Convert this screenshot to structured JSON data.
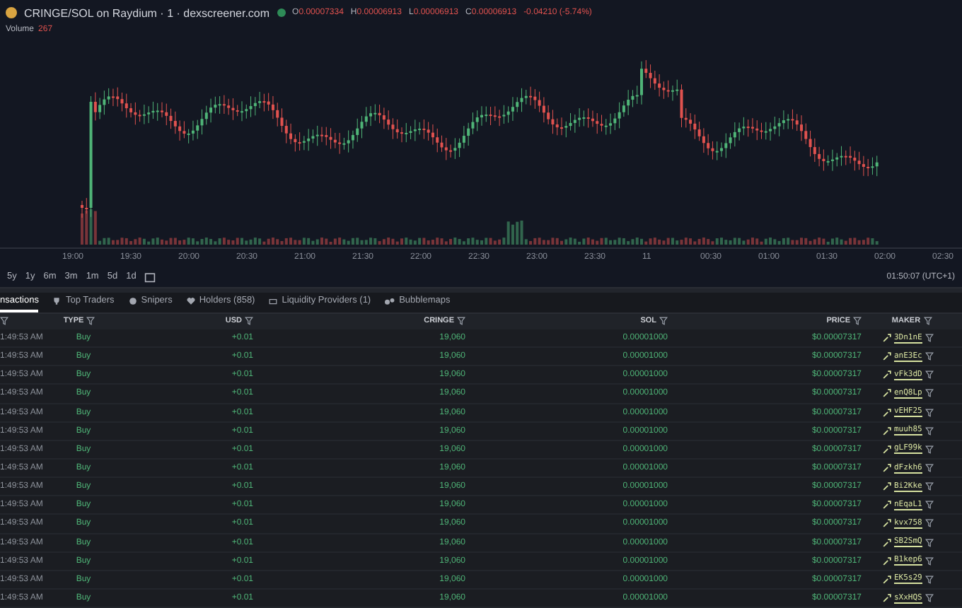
{
  "chart_header": {
    "title": "CRINGE/SOL on Raydium · 1 · dexscreener.com",
    "ohlc": [
      {
        "label": "O",
        "value": "0.00007334"
      },
      {
        "label": "H",
        "value": "0.00006913"
      },
      {
        "label": "L",
        "value": "0.00006913"
      },
      {
        "label": "C",
        "value": "0.00006913"
      }
    ],
    "change": "-0.04210 (-5.74%)",
    "volume_label": "Volume",
    "volume_value": "267"
  },
  "chart": {
    "kind": "picture",
    "time_labels": [
      "19:00",
      "19:30",
      "20:00",
      "20:30",
      "21:00",
      "21:30",
      "22:00",
      "22:30",
      "23:00",
      "23:30",
      "11",
      "00:30",
      "01:00",
      "01:30",
      "02:00",
      "02:30"
    ]
  },
  "timeframes": [
    {
      "label": "5y"
    },
    {
      "label": "1y"
    },
    {
      "label": "6m"
    },
    {
      "label": "3m"
    },
    {
      "label": "1m"
    },
    {
      "label": "5d"
    },
    {
      "label": "1d"
    }
  ],
  "clock": "01:50:07 (UTC+1)",
  "tabs": [
    {
      "label": "nsactions",
      "selected": true,
      "kind": "plain"
    },
    {
      "label": "Top Traders",
      "selected": false,
      "kind": "traders"
    },
    {
      "label": "Snipers",
      "selected": false,
      "kind": "snipers"
    },
    {
      "label": "Holders (858)",
      "selected": false,
      "kind": "holders"
    },
    {
      "label": "Liquidity Providers (1)",
      "selected": false,
      "kind": "liquidity"
    },
    {
      "label": "Bubblemaps",
      "selected": false,
      "kind": "bubbles"
    }
  ],
  "table": {
    "columns": [
      "TYPE",
      "USD",
      "CRINGE",
      "SOL",
      "PRICE",
      "MAKER"
    ],
    "rows": [
      {
        "time": "1:49:53 AM",
        "type": "Buy",
        "usd": "+0.01",
        "cringe": "19,060",
        "sol": "0.00001000",
        "price": "$0.00007317",
        "maker": "3Dn1nE"
      },
      {
        "time": "1:49:53 AM",
        "type": "Buy",
        "usd": "+0.01",
        "cringe": "19,060",
        "sol": "0.00001000",
        "price": "$0.00007317",
        "maker": "anE3Ec"
      },
      {
        "time": "1:49:53 AM",
        "type": "Buy",
        "usd": "+0.01",
        "cringe": "19,060",
        "sol": "0.00001000",
        "price": "$0.00007317",
        "maker": "vFk3dD"
      },
      {
        "time": "1:49:53 AM",
        "type": "Buy",
        "usd": "+0.01",
        "cringe": "19,060",
        "sol": "0.00001000",
        "price": "$0.00007317",
        "maker": "enQ8Lp"
      },
      {
        "time": "1:49:53 AM",
        "type": "Buy",
        "usd": "+0.01",
        "cringe": "19,060",
        "sol": "0.00001000",
        "price": "$0.00007317",
        "maker": "vEHF25"
      },
      {
        "time": "1:49:53 AM",
        "type": "Buy",
        "usd": "+0.01",
        "cringe": "19,060",
        "sol": "0.00001000",
        "price": "$0.00007317",
        "maker": "muuh85"
      },
      {
        "time": "1:49:53 AM",
        "type": "Buy",
        "usd": "+0.01",
        "cringe": "19,060",
        "sol": "0.00001000",
        "price": "$0.00007317",
        "maker": "gLF99k"
      },
      {
        "time": "1:49:53 AM",
        "type": "Buy",
        "usd": "+0.01",
        "cringe": "19,060",
        "sol": "0.00001000",
        "price": "$0.00007317",
        "maker": "dFzkh6"
      },
      {
        "time": "1:49:53 AM",
        "type": "Buy",
        "usd": "+0.01",
        "cringe": "19,060",
        "sol": "0.00001000",
        "price": "$0.00007317",
        "maker": "Bi2Kke"
      },
      {
        "time": "1:49:53 AM",
        "type": "Buy",
        "usd": "+0.01",
        "cringe": "19,060",
        "sol": "0.00001000",
        "price": "$0.00007317",
        "maker": "nEqaL1"
      },
      {
        "time": "1:49:53 AM",
        "type": "Buy",
        "usd": "+0.01",
        "cringe": "19,060",
        "sol": "0.00001000",
        "price": "$0.00007317",
        "maker": "kvx758"
      },
      {
        "time": "1:49:53 AM",
        "type": "Buy",
        "usd": "+0.01",
        "cringe": "19,060",
        "sol": "0.00001000",
        "price": "$0.00007317",
        "maker": "SB2SmQ"
      },
      {
        "time": "1:49:53 AM",
        "type": "Buy",
        "usd": "+0.01",
        "cringe": "19,060",
        "sol": "0.00001000",
        "price": "$0.00007317",
        "maker": "B1kep6"
      },
      {
        "time": "1:49:53 AM",
        "type": "Buy",
        "usd": "+0.01",
        "cringe": "19,060",
        "sol": "0.00001000",
        "price": "$0.00007317",
        "maker": "EK5s29"
      },
      {
        "time": "1:49:53 AM",
        "type": "Buy",
        "usd": "+0.01",
        "cringe": "19,060",
        "sol": "0.00001000",
        "price": "$0.00007317",
        "maker": "sXxHQS"
      }
    ]
  }
}
